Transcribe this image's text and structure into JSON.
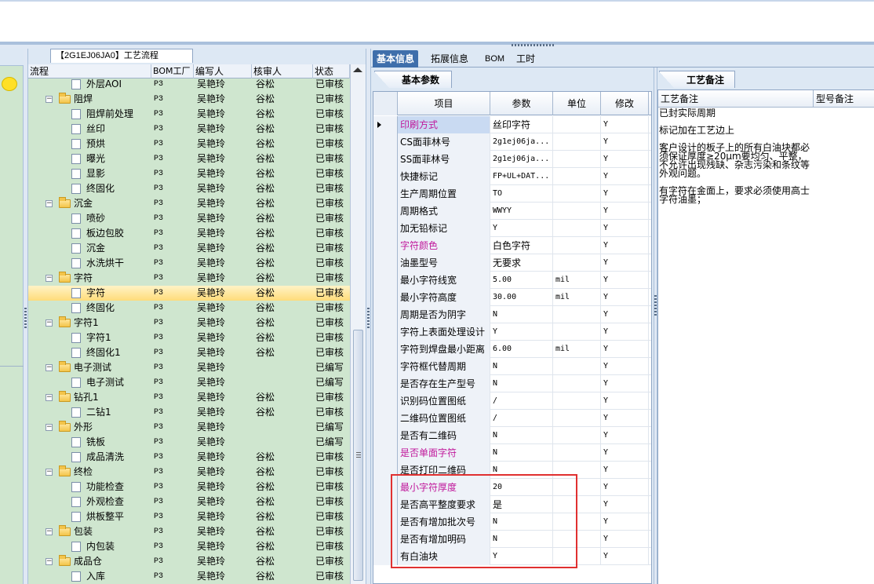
{
  "tree": {
    "tab_title": "【2G1EJ06JA0】工艺流程",
    "columns": [
      "流程",
      "BOM工厂",
      "编写人",
      "核审人",
      "状态"
    ],
    "rows": [
      {
        "level": 2,
        "kind": "file",
        "name": "外层AOI",
        "factory": "P3",
        "writer": "吴艳玲",
        "reviewer": "谷松",
        "status": "已审核"
      },
      {
        "level": 1,
        "kind": "folder",
        "name": "阻焊",
        "factory": "P3",
        "writer": "吴艳玲",
        "reviewer": "谷松",
        "status": "已审核"
      },
      {
        "level": 2,
        "kind": "file",
        "name": "阻焊前处理",
        "factory": "P3",
        "writer": "吴艳玲",
        "reviewer": "谷松",
        "status": "已审核"
      },
      {
        "level": 2,
        "kind": "file",
        "name": "丝印",
        "factory": "P3",
        "writer": "吴艳玲",
        "reviewer": "谷松",
        "status": "已审核"
      },
      {
        "level": 2,
        "kind": "file",
        "name": "预烘",
        "factory": "P3",
        "writer": "吴艳玲",
        "reviewer": "谷松",
        "status": "已审核"
      },
      {
        "level": 2,
        "kind": "file",
        "name": "曝光",
        "factory": "P3",
        "writer": "吴艳玲",
        "reviewer": "谷松",
        "status": "已审核"
      },
      {
        "level": 2,
        "kind": "file",
        "name": "显影",
        "factory": "P3",
        "writer": "吴艳玲",
        "reviewer": "谷松",
        "status": "已审核"
      },
      {
        "level": 2,
        "kind": "file",
        "name": "终固化",
        "factory": "P3",
        "writer": "吴艳玲",
        "reviewer": "谷松",
        "status": "已审核"
      },
      {
        "level": 1,
        "kind": "folder",
        "name": "沉金",
        "factory": "P3",
        "writer": "吴艳玲",
        "reviewer": "谷松",
        "status": "已审核"
      },
      {
        "level": 2,
        "kind": "file",
        "name": "喷砂",
        "factory": "P3",
        "writer": "吴艳玲",
        "reviewer": "谷松",
        "status": "已审核"
      },
      {
        "level": 2,
        "kind": "file",
        "name": "板边包胶",
        "factory": "P3",
        "writer": "吴艳玲",
        "reviewer": "谷松",
        "status": "已审核"
      },
      {
        "level": 2,
        "kind": "file",
        "name": "沉金",
        "factory": "P3",
        "writer": "吴艳玲",
        "reviewer": "谷松",
        "status": "已审核"
      },
      {
        "level": 2,
        "kind": "file",
        "name": "水洗烘干",
        "factory": "P3",
        "writer": "吴艳玲",
        "reviewer": "谷松",
        "status": "已审核"
      },
      {
        "level": 1,
        "kind": "folder",
        "name": "字符",
        "factory": "P3",
        "writer": "吴艳玲",
        "reviewer": "谷松",
        "status": "已审核"
      },
      {
        "level": 2,
        "kind": "file",
        "name": "字符",
        "factory": "P3",
        "writer": "吴艳玲",
        "reviewer": "谷松",
        "status": "已审核",
        "selected": true
      },
      {
        "level": 2,
        "kind": "file",
        "name": "终固化",
        "factory": "P3",
        "writer": "吴艳玲",
        "reviewer": "谷松",
        "status": "已审核"
      },
      {
        "level": 1,
        "kind": "folder",
        "name": "字符1",
        "factory": "P3",
        "writer": "吴艳玲",
        "reviewer": "谷松",
        "status": "已审核"
      },
      {
        "level": 2,
        "kind": "file",
        "name": "字符1",
        "factory": "P3",
        "writer": "吴艳玲",
        "reviewer": "谷松",
        "status": "已审核"
      },
      {
        "level": 2,
        "kind": "file",
        "name": "终固化1",
        "factory": "P3",
        "writer": "吴艳玲",
        "reviewer": "谷松",
        "status": "已审核"
      },
      {
        "level": 1,
        "kind": "folder",
        "name": "电子测试",
        "factory": "P3",
        "writer": "吴艳玲",
        "reviewer": "",
        "status": "已编写"
      },
      {
        "level": 2,
        "kind": "file",
        "name": "电子测试",
        "factory": "P3",
        "writer": "吴艳玲",
        "reviewer": "",
        "status": "已编写"
      },
      {
        "level": 1,
        "kind": "folder",
        "name": "钻孔1",
        "factory": "P3",
        "writer": "吴艳玲",
        "reviewer": "谷松",
        "status": "已审核"
      },
      {
        "level": 2,
        "kind": "file",
        "name": "二钻1",
        "factory": "P3",
        "writer": "吴艳玲",
        "reviewer": "谷松",
        "status": "已审核"
      },
      {
        "level": 1,
        "kind": "folder",
        "name": "外形",
        "factory": "P3",
        "writer": "吴艳玲",
        "reviewer": "",
        "status": "已编写"
      },
      {
        "level": 2,
        "kind": "file",
        "name": "铣板",
        "factory": "P3",
        "writer": "吴艳玲",
        "reviewer": "",
        "status": "已编写"
      },
      {
        "level": 2,
        "kind": "file",
        "name": "成品清洗",
        "factory": "P3",
        "writer": "吴艳玲",
        "reviewer": "谷松",
        "status": "已审核"
      },
      {
        "level": 1,
        "kind": "folder",
        "name": "终检",
        "factory": "P3",
        "writer": "吴艳玲",
        "reviewer": "谷松",
        "status": "已审核"
      },
      {
        "level": 2,
        "kind": "file",
        "name": "功能检查",
        "factory": "P3",
        "writer": "吴艳玲",
        "reviewer": "谷松",
        "status": "已审核"
      },
      {
        "level": 2,
        "kind": "file",
        "name": "外观检查",
        "factory": "P3",
        "writer": "吴艳玲",
        "reviewer": "谷松",
        "status": "已审核"
      },
      {
        "level": 2,
        "kind": "file",
        "name": "烘板整平",
        "factory": "P3",
        "writer": "吴艳玲",
        "reviewer": "谷松",
        "status": "已审核"
      },
      {
        "level": 1,
        "kind": "folder",
        "name": "包装",
        "factory": "P3",
        "writer": "吴艳玲",
        "reviewer": "谷松",
        "status": "已审核"
      },
      {
        "level": 2,
        "kind": "file",
        "name": "内包装",
        "factory": "P3",
        "writer": "吴艳玲",
        "reviewer": "谷松",
        "status": "已审核"
      },
      {
        "level": 1,
        "kind": "folder",
        "name": "成品仓",
        "factory": "P3",
        "writer": "吴艳玲",
        "reviewer": "谷松",
        "status": "已审核"
      },
      {
        "level": 2,
        "kind": "file",
        "name": "入库",
        "factory": "P3",
        "writer": "吴艳玲",
        "reviewer": "谷松",
        "status": "已审核"
      }
    ]
  },
  "main_tabs": [
    "基本信息",
    "拓展信息",
    "BOM",
    "工时"
  ],
  "basic": {
    "subtab": "基本参数",
    "columns": [
      "项目",
      "参数",
      "单位",
      "修改"
    ],
    "rows": [
      {
        "item": "印刷方式",
        "value": "丝印字符",
        "unit": "",
        "edit": "Y",
        "pink": true,
        "current": true
      },
      {
        "item": "CS面菲林号",
        "value": "2g1ej06ja...",
        "unit": "",
        "edit": "Y",
        "mono": true
      },
      {
        "item": "SS面菲林号",
        "value": "2g1ej06ja...",
        "unit": "",
        "edit": "Y",
        "mono": true
      },
      {
        "item": "快捷标记",
        "value": "FP+UL+DAT...",
        "unit": "",
        "edit": "Y",
        "mono": true
      },
      {
        "item": "生产周期位置",
        "value": "TO",
        "unit": "",
        "edit": "Y",
        "mono": true
      },
      {
        "item": "周期格式",
        "value": "WWYY",
        "unit": "",
        "edit": "Y",
        "mono": true
      },
      {
        "item": "加无铅标记",
        "value": "Y",
        "unit": "",
        "edit": "Y",
        "mono": true
      },
      {
        "item": "字符颜色",
        "value": "白色字符",
        "unit": "",
        "edit": "Y",
        "pink": true
      },
      {
        "item": "油墨型号",
        "value": "无要求",
        "unit": "",
        "edit": "Y"
      },
      {
        "item": "最小字符线宽",
        "value": "5.00",
        "unit": "mil",
        "edit": "Y",
        "mono": true
      },
      {
        "item": "最小字符高度",
        "value": "30.00",
        "unit": "mil",
        "edit": "Y",
        "mono": true
      },
      {
        "item": "周期是否为阴字",
        "value": "N",
        "unit": "",
        "edit": "Y",
        "mono": true
      },
      {
        "item": "字符上表面处理设计",
        "value": "Y",
        "unit": "",
        "edit": "Y",
        "mono": true
      },
      {
        "item": "字符到焊盘最小距离",
        "value": "6.00",
        "unit": "mil",
        "edit": "Y",
        "mono": true
      },
      {
        "item": "字符框代替周期",
        "value": "N",
        "unit": "",
        "edit": "Y",
        "mono": true
      },
      {
        "item": "是否存在生产型号",
        "value": "N",
        "unit": "",
        "edit": "Y",
        "mono": true
      },
      {
        "item": "识别码位置图纸",
        "value": "/",
        "unit": "",
        "edit": "Y",
        "mono": true
      },
      {
        "item": "二维码位置图纸",
        "value": "/",
        "unit": "",
        "edit": "Y",
        "mono": true
      },
      {
        "item": "是否有二维码",
        "value": "N",
        "unit": "",
        "edit": "Y",
        "mono": true
      },
      {
        "item": "是否单面字符",
        "value": "N",
        "unit": "",
        "edit": "Y",
        "mono": true,
        "pink": true
      },
      {
        "item": "是否打印二维码",
        "value": "N",
        "unit": "",
        "edit": "Y",
        "mono": true
      },
      {
        "item": "最小字符厚度",
        "value": "20",
        "unit": "",
        "edit": "Y",
        "mono": true,
        "pink": true
      },
      {
        "item": "是否高平整度要求",
        "value": "是",
        "unit": "",
        "edit": "Y"
      },
      {
        "item": "是否有增加批次号",
        "value": "N",
        "unit": "",
        "edit": "Y",
        "mono": true
      },
      {
        "item": "是否有增加明码",
        "value": "N",
        "unit": "",
        "edit": "Y",
        "mono": true
      },
      {
        "item": "有白油块",
        "value": "Y",
        "unit": "",
        "edit": "Y",
        "mono": true
      }
    ]
  },
  "notes": {
    "subtab": "工艺备注",
    "columns": [
      "工艺备注",
      "型号备注"
    ],
    "text": "已封实际周期\n\n标记加在工艺边上\n\n客户设计的板子上的所有白油块都必须保证厚度≥20μm要均匀、平整，不允许出现残缺、杂志污染和条纹等外观问题。\n\n有字符在金面上，要求必须使用高士字符油墨；"
  },
  "colors": {
    "pink": "#c0189b",
    "accent": "#3f6fab",
    "tree_bg": "#cfe6cf",
    "highlight": "#e03030"
  }
}
